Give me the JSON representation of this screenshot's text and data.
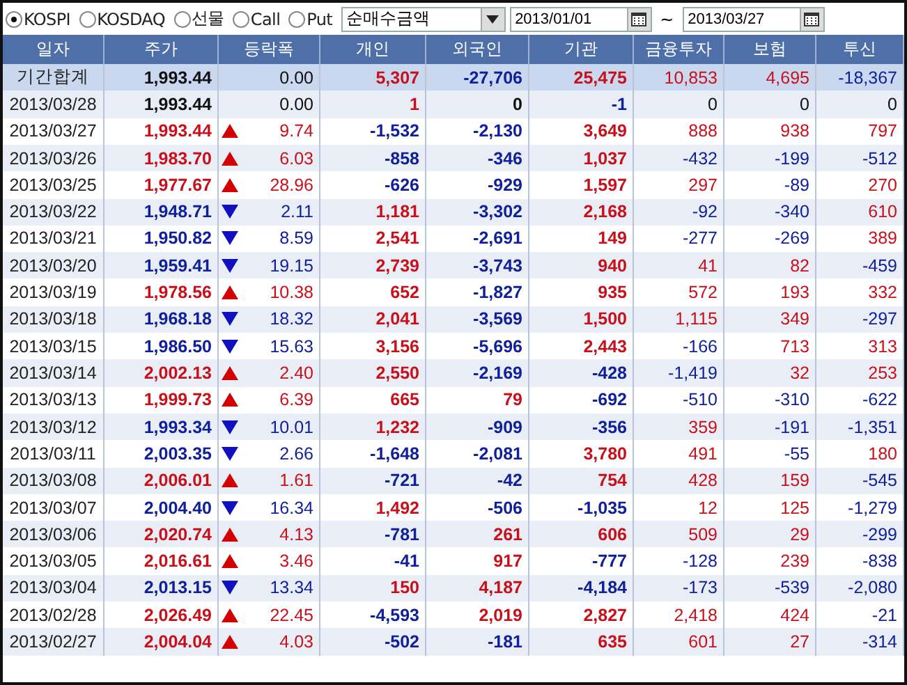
{
  "toolbar": {
    "markets": [
      {
        "label": "KOSPI",
        "selected": true
      },
      {
        "label": "KOSDAQ",
        "selected": false
      },
      {
        "label": "선물",
        "selected": false
      },
      {
        "label": "Call",
        "selected": false
      },
      {
        "label": "Put",
        "selected": false
      }
    ],
    "metric": {
      "value": "순매수금액"
    },
    "date_from": {
      "value": "2013/01/01"
    },
    "separator": "~",
    "date_to": {
      "value": "2013/03/27"
    }
  },
  "table": {
    "columns": [
      "일자",
      "주가",
      "등락폭",
      "개인",
      "외국인",
      "기관",
      "금융투자",
      "보험",
      "투신"
    ],
    "total": {
      "date": "기간합계",
      "price": "1,993.44",
      "kind": "flat",
      "change": "0.00",
      "cells": [
        "5,307",
        "-27,706",
        "25,475",
        "10,853",
        "4,695",
        "-18,367"
      ]
    },
    "rows": [
      {
        "date": "2013/03/28",
        "price": "1,993.44",
        "kind": "flat",
        "change": "0.00",
        "cells": [
          "1",
          "0",
          "-1",
          "0",
          "0",
          "0"
        ]
      },
      {
        "date": "2013/03/27",
        "price": "1,993.44",
        "kind": "up",
        "change": "9.74",
        "cells": [
          "-1,532",
          "-2,130",
          "3,649",
          "888",
          "938",
          "797"
        ]
      },
      {
        "date": "2013/03/26",
        "price": "1,983.70",
        "kind": "up",
        "change": "6.03",
        "cells": [
          "-858",
          "-346",
          "1,037",
          "-432",
          "-199",
          "-512"
        ]
      },
      {
        "date": "2013/03/25",
        "price": "1,977.67",
        "kind": "up",
        "change": "28.96",
        "cells": [
          "-626",
          "-929",
          "1,597",
          "297",
          "-89",
          "270"
        ]
      },
      {
        "date": "2013/03/22",
        "price": "1,948.71",
        "kind": "down",
        "change": "2.11",
        "cells": [
          "1,181",
          "-3,302",
          "2,168",
          "-92",
          "-340",
          "610"
        ]
      },
      {
        "date": "2013/03/21",
        "price": "1,950.82",
        "kind": "down",
        "change": "8.59",
        "cells": [
          "2,541",
          "-2,691",
          "149",
          "-277",
          "-269",
          "389"
        ]
      },
      {
        "date": "2013/03/20",
        "price": "1,959.41",
        "kind": "down",
        "change": "19.15",
        "cells": [
          "2,739",
          "-3,743",
          "940",
          "41",
          "82",
          "-459"
        ]
      },
      {
        "date": "2013/03/19",
        "price": "1,978.56",
        "kind": "up",
        "change": "10.38",
        "cells": [
          "652",
          "-1,827",
          "935",
          "572",
          "193",
          "332"
        ]
      },
      {
        "date": "2013/03/18",
        "price": "1,968.18",
        "kind": "down",
        "change": "18.32",
        "cells": [
          "2,041",
          "-3,569",
          "1,500",
          "1,115",
          "349",
          "-297"
        ]
      },
      {
        "date": "2013/03/15",
        "price": "1,986.50",
        "kind": "down",
        "change": "15.63",
        "cells": [
          "3,156",
          "-5,696",
          "2,443",
          "-166",
          "713",
          "313"
        ]
      },
      {
        "date": "2013/03/14",
        "price": "2,002.13",
        "kind": "up",
        "change": "2.40",
        "cells": [
          "2,550",
          "-2,169",
          "-428",
          "-1,419",
          "32",
          "253"
        ]
      },
      {
        "date": "2013/03/13",
        "price": "1,999.73",
        "kind": "up",
        "change": "6.39",
        "cells": [
          "665",
          "79",
          "-692",
          "-510",
          "-310",
          "-622"
        ]
      },
      {
        "date": "2013/03/12",
        "price": "1,993.34",
        "kind": "down",
        "change": "10.01",
        "cells": [
          "1,232",
          "-909",
          "-356",
          "359",
          "-191",
          "-1,351"
        ]
      },
      {
        "date": "2013/03/11",
        "price": "2,003.35",
        "kind": "down",
        "change": "2.66",
        "cells": [
          "-1,648",
          "-2,081",
          "3,780",
          "491",
          "-55",
          "180"
        ]
      },
      {
        "date": "2013/03/08",
        "price": "2,006.01",
        "kind": "up",
        "change": "1.61",
        "cells": [
          "-721",
          "-42",
          "754",
          "428",
          "159",
          "-545"
        ]
      },
      {
        "date": "2013/03/07",
        "price": "2,004.40",
        "kind": "down",
        "change": "16.34",
        "cells": [
          "1,492",
          "-506",
          "-1,035",
          "12",
          "125",
          "-1,279"
        ]
      },
      {
        "date": "2013/03/06",
        "price": "2,020.74",
        "kind": "up",
        "change": "4.13",
        "cells": [
          "-781",
          "261",
          "606",
          "509",
          "29",
          "-299"
        ]
      },
      {
        "date": "2013/03/05",
        "price": "2,016.61",
        "kind": "up",
        "change": "3.46",
        "cells": [
          "-41",
          "917",
          "-777",
          "-128",
          "239",
          "-838"
        ]
      },
      {
        "date": "2013/03/04",
        "price": "2,013.15",
        "kind": "down",
        "change": "13.34",
        "cells": [
          "150",
          "4,187",
          "-4,184",
          "-173",
          "-539",
          "-2,080"
        ]
      },
      {
        "date": "2013/02/28",
        "price": "2,026.49",
        "kind": "up",
        "change": "22.45",
        "cells": [
          "-4,593",
          "2,019",
          "2,827",
          "2,418",
          "424",
          "-21"
        ]
      },
      {
        "date": "2013/02/27",
        "price": "2,004.04",
        "kind": "up",
        "change": "4.03",
        "cells": [
          "-502",
          "-181",
          "635",
          "601",
          "27",
          "-314"
        ]
      }
    ]
  }
}
